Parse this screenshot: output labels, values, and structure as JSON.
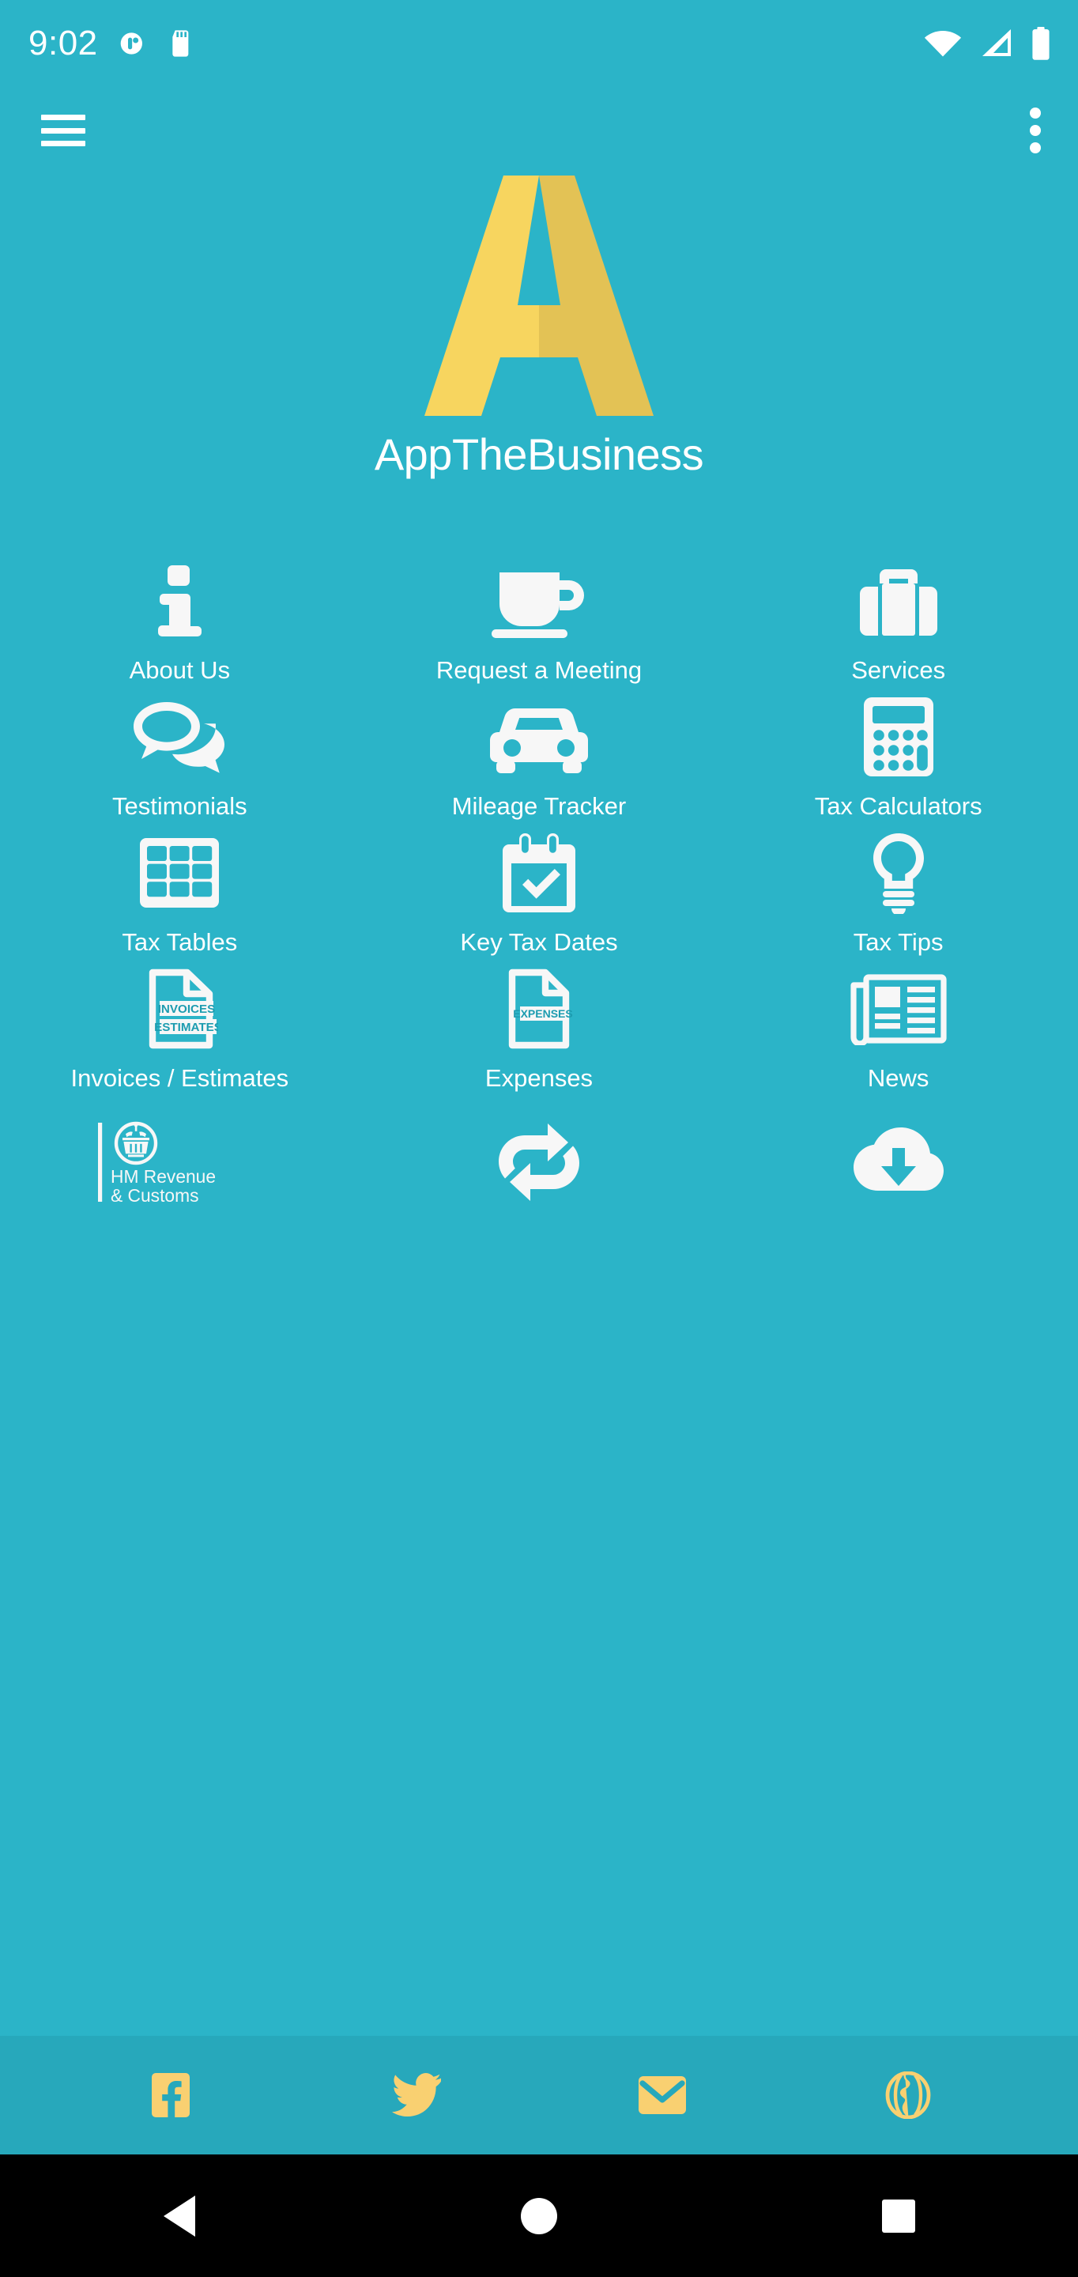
{
  "status_bar": {
    "time": "9:02",
    "left_icons": [
      "do-not-disturb-icon",
      "sd-card-icon"
    ],
    "right_icons": [
      "wifi-icon",
      "cellular-signal-icon",
      "battery-icon"
    ]
  },
  "app_bar": {
    "menu_icon": "hamburger-menu-icon",
    "overflow_icon": "overflow-menu-icon"
  },
  "brand": {
    "logo_icon": "appthebusiness-logo-a-icon",
    "name": "AppTheBusiness",
    "logo_color_light": "#F7D55F",
    "logo_color_dark": "#E3C255"
  },
  "theme": {
    "background": "#2BB4C8",
    "social_bar_background": "#27A8BB",
    "icon_color": "#F7F7F7",
    "accent_yellow": "#F9D071",
    "text_color": "#FFFFFF",
    "nav_bar_background": "#000000"
  },
  "grid": {
    "tiles": [
      {
        "label": "About Us",
        "icon": "info-icon"
      },
      {
        "label": "Request a Meeting",
        "icon": "coffee-cup-icon"
      },
      {
        "label": "Services",
        "icon": "briefcase-icon"
      },
      {
        "label": "Testimonials",
        "icon": "speech-bubbles-icon"
      },
      {
        "label": "Mileage Tracker",
        "icon": "car-icon"
      },
      {
        "label": "Tax Calculators",
        "icon": "calculator-icon"
      },
      {
        "label": "Tax Tables",
        "icon": "table-grid-icon"
      },
      {
        "label": "Key Tax Dates",
        "icon": "calendar-check-icon"
      },
      {
        "label": "Tax Tips",
        "icon": "lightbulb-icon"
      },
      {
        "label": "Invoices / Estimates",
        "icon": "document-invoices-estimates-icon"
      },
      {
        "label": "Expenses",
        "icon": "document-expenses-icon"
      },
      {
        "label": "News",
        "icon": "newspaper-icon"
      },
      {
        "label": "",
        "icon": "hmrc-logo-icon"
      },
      {
        "label": "",
        "icon": "sync-arrows-icon"
      },
      {
        "label": "",
        "icon": "cloud-download-icon"
      }
    ],
    "document_badges": {
      "invoices": "INVOICES",
      "estimates": "ESTIMATES",
      "expenses": "EXPENSES"
    },
    "hmrc": {
      "line1": "HM Revenue",
      "line2": "& Customs"
    }
  },
  "social_bar": {
    "buttons": [
      {
        "icon": "facebook-icon"
      },
      {
        "icon": "twitter-icon"
      },
      {
        "icon": "email-icon"
      },
      {
        "icon": "globe-web-icon"
      }
    ]
  },
  "nav_bar": {
    "buttons": [
      {
        "icon": "back-triangle-icon"
      },
      {
        "icon": "home-circle-icon"
      },
      {
        "icon": "recents-square-icon"
      }
    ]
  }
}
